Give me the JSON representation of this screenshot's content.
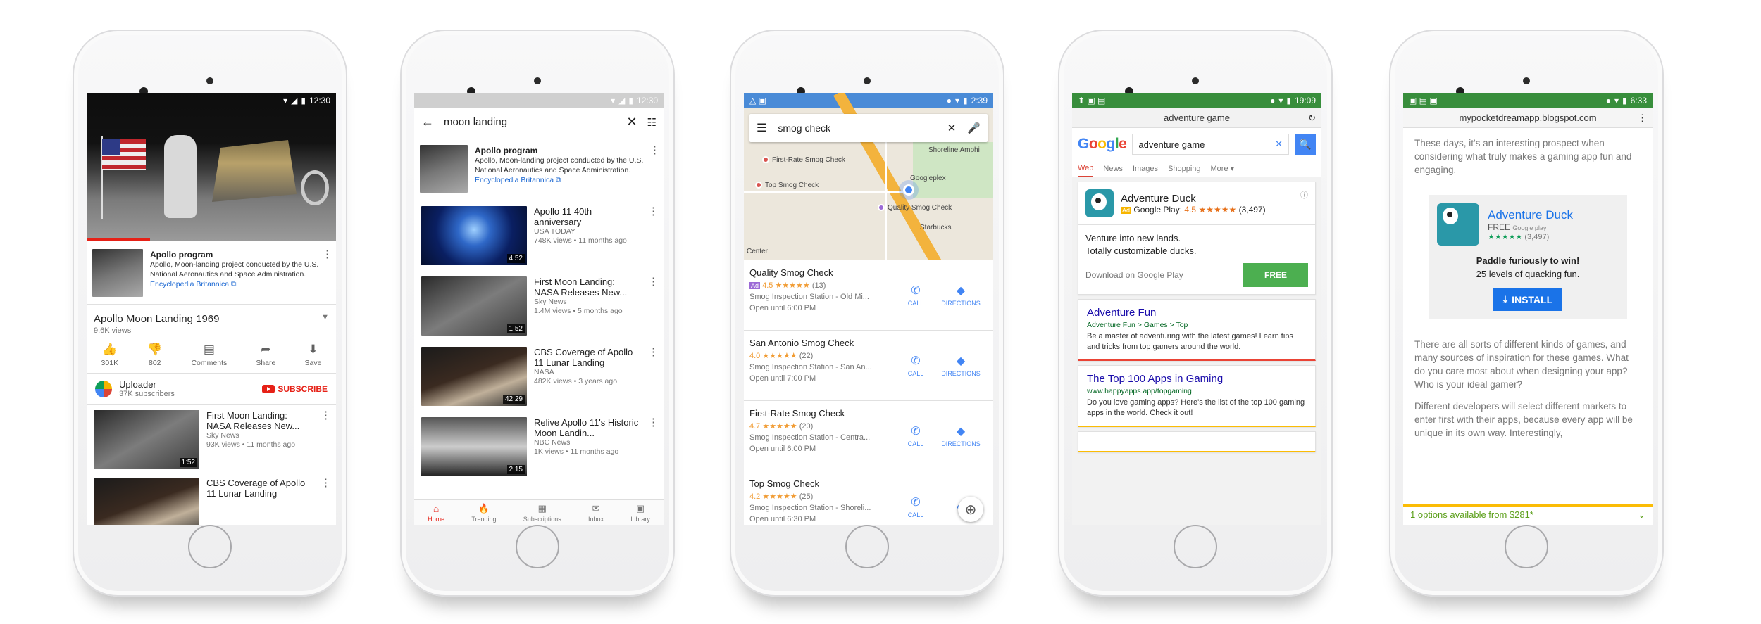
{
  "phone1": {
    "status": {
      "time": "12:30"
    },
    "panel": {
      "title": "Apollo program",
      "desc": "Apollo, Moon-landing project conducted by the U.S. National Aeronautics and Space Administration.",
      "source": "Encyclopedia Britannica"
    },
    "video": {
      "title": "Apollo Moon Landing 1969",
      "views": "9.6K views"
    },
    "actions": [
      {
        "icon": "👍",
        "label": "301K"
      },
      {
        "icon": "👎",
        "label": "802"
      },
      {
        "icon": "▤",
        "label": "Comments"
      },
      {
        "icon": "➦",
        "label": "Share"
      },
      {
        "icon": "⬇",
        "label": "Save"
      }
    ],
    "uploader": {
      "name": "Uploader",
      "subs": "37K subscribers",
      "subscribe": "SUBSCRIBE"
    },
    "related": [
      {
        "title": "First Moon Landing: NASA Releases New...",
        "channel": "Sky News",
        "meta": "93K views • 11 months ago",
        "dur": "1:52"
      },
      {
        "title": "CBS Coverage of Apollo 11 Lunar Landing",
        "channel": "",
        "meta": "",
        "dur": ""
      }
    ]
  },
  "phone2": {
    "status": {
      "time": "12:30"
    },
    "query": "moon landing",
    "panel": {
      "title": "Apollo program",
      "desc": "Apollo, Moon-landing project conducted by the U.S. National Aeronautics and Space Administration.",
      "source": "Encyclopedia Britannica"
    },
    "results": [
      {
        "title": "Apollo 11 40th anniversary",
        "channel": "USA TODAY",
        "meta": "748K views • 11 months ago",
        "dur": "4:52"
      },
      {
        "title": "First Moon Landing: NASA Releases New...",
        "channel": "Sky News",
        "meta": "1.4M views • 5 months ago",
        "dur": "1:52"
      },
      {
        "title": "CBS Coverage of Apollo 11 Lunar Landing",
        "channel": "NASA",
        "meta": "482K views • 3 years ago",
        "dur": "42:29"
      },
      {
        "title": "Relive Apollo 11's Historic Moon Landin...",
        "channel": "NBC News",
        "meta": "1K views • 11 months ago",
        "dur": "2:15"
      }
    ],
    "nav": [
      {
        "icon": "⌂",
        "label": "Home"
      },
      {
        "icon": "🔥",
        "label": "Trending"
      },
      {
        "icon": "▦",
        "label": "Subscriptions"
      },
      {
        "icon": "✉",
        "label": "Inbox"
      },
      {
        "icon": "▣",
        "label": "Library"
      }
    ]
  },
  "phone3": {
    "status": {
      "time": "2:39"
    },
    "query": "smog check",
    "map_labels": [
      "First-Rate Smog Check",
      "Top Smog Check",
      "Googleplex",
      "Quality Smog Check",
      "Shoreline Amphi",
      "Starbucks",
      "Center"
    ],
    "call_label": "CALL",
    "dir_label": "DIRECTIONS",
    "places": [
      {
        "name": "Quality Smog Check",
        "ad": "Ad",
        "rating": "4.5",
        "stars": "★★★★★",
        "count": "(13)",
        "type": "Smog Inspection Station - Old Mi...",
        "hours": "Open until 6:00 PM"
      },
      {
        "name": "San Antonio Smog Check",
        "ad": "",
        "rating": "4.0",
        "stars": "★★★★★",
        "count": "(22)",
        "type": "Smog Inspection Station - San An...",
        "hours": "Open until 7:00 PM"
      },
      {
        "name": "First-Rate Smog Check",
        "ad": "",
        "rating": "4.7",
        "stars": "★★★★★",
        "count": "(20)",
        "type": "Smog Inspection Station - Centra...",
        "hours": "Open until 6:00 PM"
      },
      {
        "name": "Top Smog Check",
        "ad": "",
        "rating": "4.2",
        "stars": "★★★★★",
        "count": "(25)",
        "type": "Smog Inspection Station - Shoreli...",
        "hours": "Open until 6:30 PM"
      }
    ]
  },
  "phone4": {
    "status": {
      "time": "19:09"
    },
    "url": "adventure game",
    "logo": "Google",
    "query": "adventure game",
    "tabs": [
      "Web",
      "News",
      "Images",
      "Shopping",
      "More ▾"
    ],
    "app": {
      "name": "Adventure Duck",
      "ad": "Ad",
      "source": "Google Play:",
      "rating": "4.5",
      "stars": "★★★★★",
      "count": "(3,497)",
      "line1": "Venture into new lands.",
      "line2": "Totally customizable ducks.",
      "download": "Download on Google Play",
      "button": "FREE"
    },
    "results": [
      {
        "title": "Adventure Fun",
        "url": "Adventure Fun > Games > Top",
        "desc": "Be a master of adventuring with the latest games! Learn tips and tricks from top gamers around the world."
      },
      {
        "title": "The Top 100 Apps in Gaming",
        "url": "www.happyapps.app/topgaming",
        "desc": "Do you love gaming apps? Here's the list of the top 100 gaming apps in the world. Check it out!"
      }
    ]
  },
  "phone5": {
    "status": {
      "time": "6:33"
    },
    "url": "mypocketdreamapp.blogspot.com",
    "intro": "These days, it's an interesting prospect when considering what truly makes a gaming app fun and engaging.",
    "ad": {
      "name": "Adventure Duck",
      "price": "FREE",
      "store": "Google play",
      "stars": "★★★★★",
      "count": "(3,497)",
      "line1": "Paddle furiously to win!",
      "line2": "25 levels of quacking fun.",
      "button": "INSTALL"
    },
    "para1": "There are all sorts of different kinds of games, and many sources of inspiration for these games. What do you care most about when designing your app? Who is your ideal gamer?",
    "para2": "Different developers will select different markets to enter first with their apps, because every app will be unique in its own way. Interestingly,",
    "footer": "1 options available from $281*"
  }
}
